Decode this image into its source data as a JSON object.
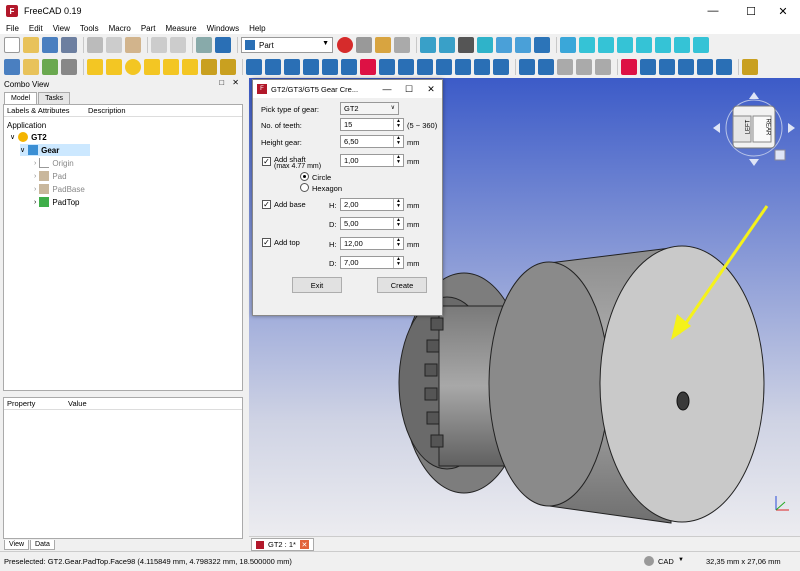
{
  "app": {
    "title": "FreeCAD 0.19"
  },
  "menu": [
    "File",
    "Edit",
    "View",
    "Tools",
    "Macro",
    "Part",
    "Measure",
    "Windows",
    "Help"
  ],
  "toolbar": {
    "workbench": "Part"
  },
  "combo": {
    "title": "Combo View",
    "tabs": [
      "Model",
      "Tasks"
    ],
    "tree_headers": [
      "Labels & Attributes",
      "Description"
    ],
    "tree": {
      "root": "Application",
      "doc": "GT2",
      "body": "Gear",
      "children": [
        "Origin",
        "Pad",
        "PadBase",
        "PadTop"
      ]
    },
    "prop_headers": [
      "Property",
      "Value"
    ],
    "bottom_tabs": [
      "View",
      "Data"
    ]
  },
  "dialog": {
    "title": "GT2/GT3/GT5 Gear Cre...",
    "gear_type_label": "Pick type of gear:",
    "gear_type_value": "GT2",
    "teeth_label": "No. of teeth:",
    "teeth_value": "15",
    "teeth_range": "(5 ~ 360)",
    "height_label": "Height gear:",
    "height_value": "6,50",
    "unit": "mm",
    "shaft_label": "Add shaft",
    "shaft_max": "(max 4.77 mm)",
    "shaft_value": "1,00",
    "circle_label": "Circle",
    "hexagon_label": "Hexagon",
    "base_label": "Add base",
    "base_h_label": "H:",
    "base_h_value": "2,00",
    "base_d_label": "D:",
    "base_d_value": "5,00",
    "top_label": "Add top",
    "top_h_label": "H:",
    "top_h_value": "12,00",
    "top_d_label": "D:",
    "top_d_value": "7,00",
    "exit_label": "Exit",
    "create_label": "Create"
  },
  "navcube": {
    "left": "LEFT",
    "front": "REAR"
  },
  "doc_tab": {
    "label": "GT2 : 1*"
  },
  "status": {
    "preselected": "Preselected: GT2.Gear.PadTop.Face98 (4.115849 mm, 4.798322 mm, 18.500000 mm)",
    "nav_style": "CAD",
    "dimensions": "32,35 mm x 27,06 mm"
  },
  "colors": {
    "accent_red": "#b2182b",
    "arrow_yellow": "#f5f21a",
    "viewport_top": "#3c5bc8"
  }
}
